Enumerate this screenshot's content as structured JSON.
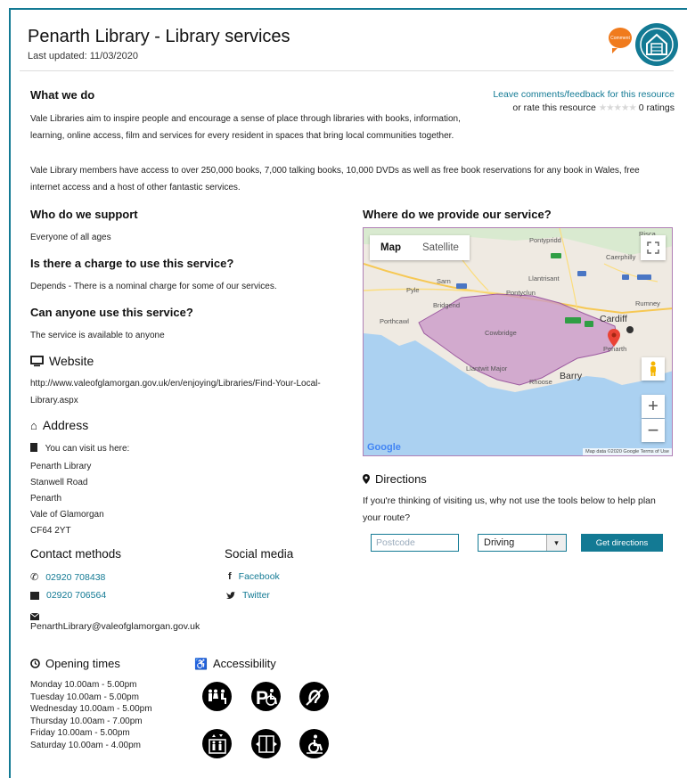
{
  "header": {
    "title": "Penarth Library - Library services",
    "last_updated": "Last updated: 11/03/2020",
    "comment_bubble_text": "Comment"
  },
  "feedback": {
    "link": "Leave comments/feedback for this resource",
    "rate_text": "or rate this resource",
    "stars": "★★★★★",
    "ratings": "0 ratings"
  },
  "what_we_do": {
    "heading": "What we do",
    "para1": "Vale Libraries aim to inspire people and encourage a sense of place through libraries with books, information, learning, online access, film and services for every resident in spaces that bring local communities together.",
    "para2": "Vale Library members have access to over 250,000 books, 7,000 talking books, 10,000 DVDs as well as free book reservations for any book in Wales, free internet access and a host of other fantastic services."
  },
  "support": {
    "heading": "Who do we support",
    "text": "Everyone of all ages"
  },
  "charge": {
    "heading": "Is there a charge to use this service?",
    "text": "Depends - There is a nominal charge for some of our services."
  },
  "anyone": {
    "heading": "Can anyone use this service?",
    "text": "The service is available to anyone"
  },
  "website": {
    "heading": "Website",
    "url": "http://www.valeofglamorgan.gov.uk/en/enjoying/Libraries/Find-Your-Local-Library.aspx"
  },
  "address": {
    "heading": "Address",
    "visit_text": "You can visit us here:",
    "lines": [
      "Penarth Library",
      "Stanwell Road",
      "Penarth",
      "Vale of Glamorgan",
      "CF64 2YT"
    ]
  },
  "contact": {
    "heading": "Contact methods",
    "phone": "02920 708438",
    "fax": "02920 706564",
    "email": "PenarthLibrary@valeofglamorgan.gov.uk"
  },
  "social": {
    "heading": "Social media",
    "facebook": "Facebook",
    "twitter": "Twitter"
  },
  "hours": {
    "heading": "Opening times",
    "days": [
      "Monday 10.00am - 5.00pm",
      "Tuesday 10.00am - 5.00pm",
      "Wednesday 10.00am - 5.00pm",
      "Thursday 10.00am - 7.00pm",
      "Friday 10.00am - 5.00pm",
      "Saturday 10.00am - 4.00pm"
    ]
  },
  "accessibility": {
    "heading": "Accessibility"
  },
  "where": {
    "heading": "Where do we provide our service?"
  },
  "map": {
    "tab_map": "Map",
    "tab_satellite": "Satellite",
    "labels": {
      "pontypridd": "Pontypridd",
      "caerphilly": "Caerphilly",
      "llantrisant": "Llantrisant",
      "sarn": "Sarn",
      "pyle": "Pyle",
      "pontyclun": "Pontyclun",
      "bridgend": "Bridgend",
      "rumney": "Rumney",
      "porthcawl": "Porthcawl",
      "cowbridge": "Cowbridge",
      "cardiff": "Cardiff",
      "penarth": "Penarth",
      "llantwit": "Llantwit Major",
      "barry": "Barry",
      "rhoose": "Rhoose",
      "risca": "Risca"
    },
    "google": "Google",
    "attribution": "Map data ©2020 Google   Terms of Use"
  },
  "directions": {
    "heading": "Directions",
    "text": "If you're thinking of visiting us, why not use the tools below to help plan your route?",
    "postcode_placeholder": "Postcode",
    "mode": "Driving",
    "button": "Get directions"
  }
}
